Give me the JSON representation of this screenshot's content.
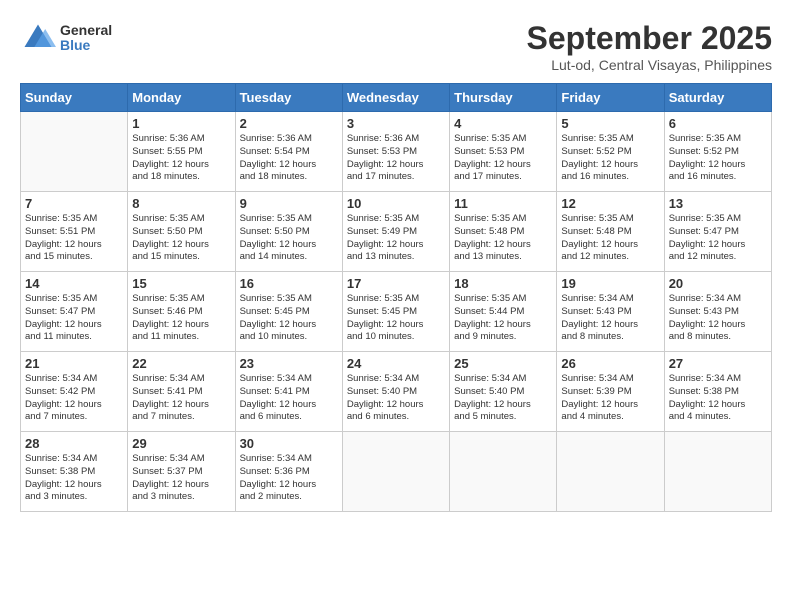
{
  "header": {
    "logo_general": "General",
    "logo_blue": "Blue",
    "month_title": "September 2025",
    "location": "Lut-od, Central Visayas, Philippines"
  },
  "weekdays": [
    "Sunday",
    "Monday",
    "Tuesday",
    "Wednesday",
    "Thursday",
    "Friday",
    "Saturday"
  ],
  "weeks": [
    [
      {
        "day": "",
        "info": ""
      },
      {
        "day": "1",
        "info": "Sunrise: 5:36 AM\nSunset: 5:55 PM\nDaylight: 12 hours\nand 18 minutes."
      },
      {
        "day": "2",
        "info": "Sunrise: 5:36 AM\nSunset: 5:54 PM\nDaylight: 12 hours\nand 18 minutes."
      },
      {
        "day": "3",
        "info": "Sunrise: 5:36 AM\nSunset: 5:53 PM\nDaylight: 12 hours\nand 17 minutes."
      },
      {
        "day": "4",
        "info": "Sunrise: 5:35 AM\nSunset: 5:53 PM\nDaylight: 12 hours\nand 17 minutes."
      },
      {
        "day": "5",
        "info": "Sunrise: 5:35 AM\nSunset: 5:52 PM\nDaylight: 12 hours\nand 16 minutes."
      },
      {
        "day": "6",
        "info": "Sunrise: 5:35 AM\nSunset: 5:52 PM\nDaylight: 12 hours\nand 16 minutes."
      }
    ],
    [
      {
        "day": "7",
        "info": "Sunrise: 5:35 AM\nSunset: 5:51 PM\nDaylight: 12 hours\nand 15 minutes."
      },
      {
        "day": "8",
        "info": "Sunrise: 5:35 AM\nSunset: 5:50 PM\nDaylight: 12 hours\nand 15 minutes."
      },
      {
        "day": "9",
        "info": "Sunrise: 5:35 AM\nSunset: 5:50 PM\nDaylight: 12 hours\nand 14 minutes."
      },
      {
        "day": "10",
        "info": "Sunrise: 5:35 AM\nSunset: 5:49 PM\nDaylight: 12 hours\nand 13 minutes."
      },
      {
        "day": "11",
        "info": "Sunrise: 5:35 AM\nSunset: 5:48 PM\nDaylight: 12 hours\nand 13 minutes."
      },
      {
        "day": "12",
        "info": "Sunrise: 5:35 AM\nSunset: 5:48 PM\nDaylight: 12 hours\nand 12 minutes."
      },
      {
        "day": "13",
        "info": "Sunrise: 5:35 AM\nSunset: 5:47 PM\nDaylight: 12 hours\nand 12 minutes."
      }
    ],
    [
      {
        "day": "14",
        "info": "Sunrise: 5:35 AM\nSunset: 5:47 PM\nDaylight: 12 hours\nand 11 minutes."
      },
      {
        "day": "15",
        "info": "Sunrise: 5:35 AM\nSunset: 5:46 PM\nDaylight: 12 hours\nand 11 minutes."
      },
      {
        "day": "16",
        "info": "Sunrise: 5:35 AM\nSunset: 5:45 PM\nDaylight: 12 hours\nand 10 minutes."
      },
      {
        "day": "17",
        "info": "Sunrise: 5:35 AM\nSunset: 5:45 PM\nDaylight: 12 hours\nand 10 minutes."
      },
      {
        "day": "18",
        "info": "Sunrise: 5:35 AM\nSunset: 5:44 PM\nDaylight: 12 hours\nand 9 minutes."
      },
      {
        "day": "19",
        "info": "Sunrise: 5:34 AM\nSunset: 5:43 PM\nDaylight: 12 hours\nand 8 minutes."
      },
      {
        "day": "20",
        "info": "Sunrise: 5:34 AM\nSunset: 5:43 PM\nDaylight: 12 hours\nand 8 minutes."
      }
    ],
    [
      {
        "day": "21",
        "info": "Sunrise: 5:34 AM\nSunset: 5:42 PM\nDaylight: 12 hours\nand 7 minutes."
      },
      {
        "day": "22",
        "info": "Sunrise: 5:34 AM\nSunset: 5:41 PM\nDaylight: 12 hours\nand 7 minutes."
      },
      {
        "day": "23",
        "info": "Sunrise: 5:34 AM\nSunset: 5:41 PM\nDaylight: 12 hours\nand 6 minutes."
      },
      {
        "day": "24",
        "info": "Sunrise: 5:34 AM\nSunset: 5:40 PM\nDaylight: 12 hours\nand 6 minutes."
      },
      {
        "day": "25",
        "info": "Sunrise: 5:34 AM\nSunset: 5:40 PM\nDaylight: 12 hours\nand 5 minutes."
      },
      {
        "day": "26",
        "info": "Sunrise: 5:34 AM\nSunset: 5:39 PM\nDaylight: 12 hours\nand 4 minutes."
      },
      {
        "day": "27",
        "info": "Sunrise: 5:34 AM\nSunset: 5:38 PM\nDaylight: 12 hours\nand 4 minutes."
      }
    ],
    [
      {
        "day": "28",
        "info": "Sunrise: 5:34 AM\nSunset: 5:38 PM\nDaylight: 12 hours\nand 3 minutes."
      },
      {
        "day": "29",
        "info": "Sunrise: 5:34 AM\nSunset: 5:37 PM\nDaylight: 12 hours\nand 3 minutes."
      },
      {
        "day": "30",
        "info": "Sunrise: 5:34 AM\nSunset: 5:36 PM\nDaylight: 12 hours\nand 2 minutes."
      },
      {
        "day": "",
        "info": ""
      },
      {
        "day": "",
        "info": ""
      },
      {
        "day": "",
        "info": ""
      },
      {
        "day": "",
        "info": ""
      }
    ]
  ]
}
